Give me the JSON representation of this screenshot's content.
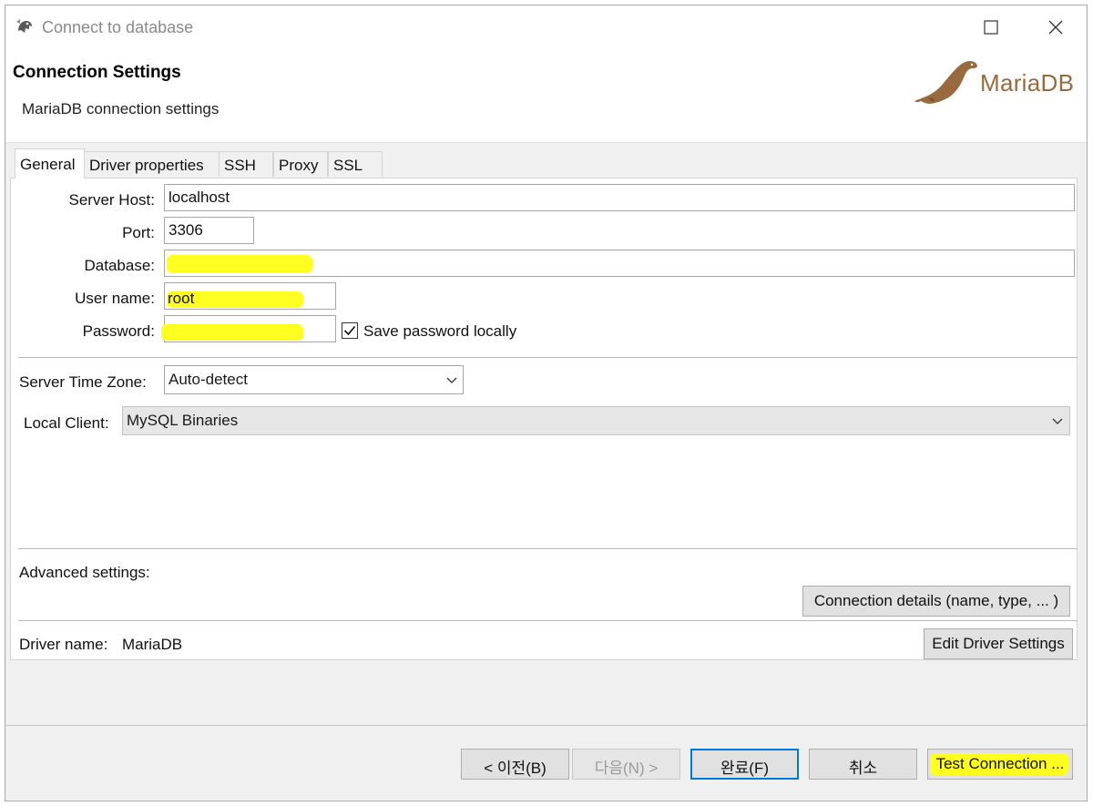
{
  "window": {
    "title": "Connect to database"
  },
  "header": {
    "title": "Connection Settings",
    "subtitle": "MariaDB connection settings",
    "logo_text": "MariaDB"
  },
  "tabs": [
    {
      "label": "General",
      "active": true
    },
    {
      "label": "Driver properties",
      "active": false
    },
    {
      "label": "SSH",
      "active": false
    },
    {
      "label": "Proxy",
      "active": false
    },
    {
      "label": "SSL",
      "active": false
    }
  ],
  "form": {
    "server_host": {
      "label": "Server Host:",
      "value": "localhost"
    },
    "port": {
      "label": "Port:",
      "value": "3306"
    },
    "database": {
      "label": "Database:",
      "value": ""
    },
    "user_name": {
      "label": "User name:",
      "value": "root"
    },
    "password": {
      "label": "Password:",
      "value": ""
    },
    "save_password": {
      "label": "Save password locally",
      "checked": true
    },
    "server_time_zone": {
      "label": "Server Time Zone:",
      "value": "Auto-detect"
    },
    "local_client": {
      "label": "Local Client:",
      "value": "MySQL Binaries"
    }
  },
  "advanced": {
    "label": "Advanced settings:",
    "connection_details_button": "Connection details (name, type, ... )"
  },
  "driver": {
    "label": "Driver name:",
    "value": "MariaDB",
    "edit_button": "Edit Driver Settings"
  },
  "footer": {
    "back_button": "< 이전(B)",
    "next_button": "다음(N) >",
    "finish_button": "완료(F)",
    "cancel_button": "취소",
    "test_button": "Test Connection ..."
  },
  "colors": {
    "highlight": "#ffff22",
    "default_button_border": "#0078d7",
    "logo_brown": "#9a6a3f"
  }
}
